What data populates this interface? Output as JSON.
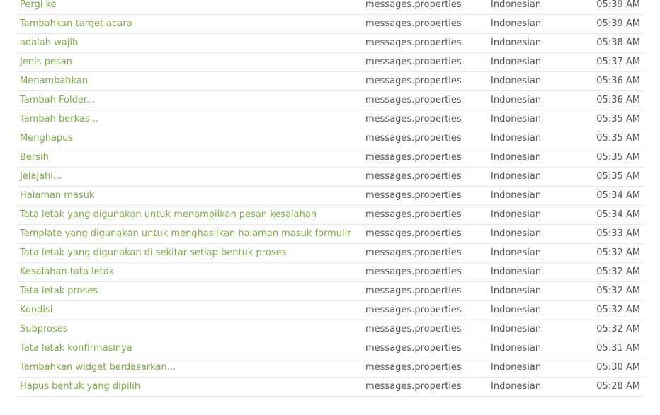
{
  "rows": [
    {
      "text": "Pergi ke",
      "file": "messages.properties",
      "language": "Indonesian",
      "time": "05:39 AM"
    },
    {
      "text": "Tambahkan target acara",
      "file": "messages.properties",
      "language": "Indonesian",
      "time": "05:39 AM"
    },
    {
      "text": "adalah wajib",
      "file": "messages.properties",
      "language": "Indonesian",
      "time": "05:38 AM"
    },
    {
      "text": "Jenis pesan",
      "file": "messages.properties",
      "language": "Indonesian",
      "time": "05:37 AM"
    },
    {
      "text": "Menambahkan",
      "file": "messages.properties",
      "language": "Indonesian",
      "time": "05:36 AM"
    },
    {
      "text": "Tambah Folder...",
      "file": "messages.properties",
      "language": "Indonesian",
      "time": "05:36 AM"
    },
    {
      "text": "Tambah berkas...",
      "file": "messages.properties",
      "language": "Indonesian",
      "time": "05:35 AM"
    },
    {
      "text": "Menghapus",
      "file": "messages.properties",
      "language": "Indonesian",
      "time": "05:35 AM"
    },
    {
      "text": "Bersih",
      "file": "messages.properties",
      "language": "Indonesian",
      "time": "05:35 AM"
    },
    {
      "text": "Jelajahi...",
      "file": "messages.properties",
      "language": "Indonesian",
      "time": "05:35 AM"
    },
    {
      "text": "Halaman masuk",
      "file": "messages.properties",
      "language": "Indonesian",
      "time": "05:34 AM"
    },
    {
      "text": "Tata letak yang digunakan untuk menampilkan pesan kesalahan",
      "file": "messages.properties",
      "language": "Indonesian",
      "time": "05:34 AM"
    },
    {
      "text": "Template yang digunakan untuk menghasilkan halaman masuk formulir",
      "file": "messages.properties",
      "language": "Indonesian",
      "time": "05:33 AM"
    },
    {
      "text": "Tata letak yang digunakan di sekitar setiap bentuk proses",
      "file": "messages.properties",
      "language": "Indonesian",
      "time": "05:32 AM"
    },
    {
      "text": "Kesalahan tata letak",
      "file": "messages.properties",
      "language": "Indonesian",
      "time": "05:32 AM"
    },
    {
      "text": "Tata letak proses",
      "file": "messages.properties",
      "language": "Indonesian",
      "time": "05:32 AM"
    },
    {
      "text": "Kondisi",
      "file": "messages.properties",
      "language": "Indonesian",
      "time": "05:32 AM"
    },
    {
      "text": "Subproses",
      "file": "messages.properties",
      "language": "Indonesian",
      "time": "05:32 AM"
    },
    {
      "text": "Tata letak konfirmasinya",
      "file": "messages.properties",
      "language": "Indonesian",
      "time": "05:31 AM"
    },
    {
      "text": "Tambahkan widget berdasarkan...",
      "file": "messages.properties",
      "language": "Indonesian",
      "time": "05:30 AM"
    },
    {
      "text": "Hapus bentuk yang dipilih",
      "file": "messages.properties",
      "language": "Indonesian",
      "time": "05:28 AM"
    }
  ],
  "colors": {
    "link": "#7da74a",
    "text": "#555555",
    "divider": "#e9e9e9"
  }
}
